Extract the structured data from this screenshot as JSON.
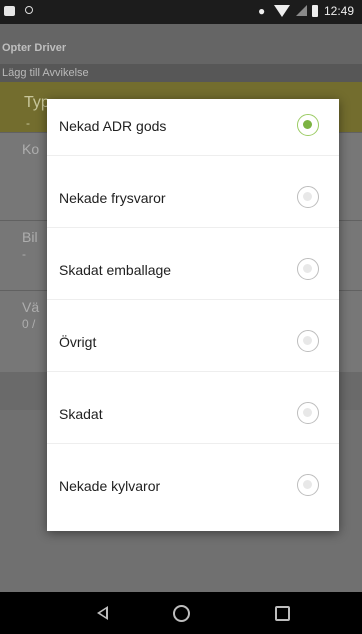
{
  "status_bar": {
    "time": "12:49",
    "icons": [
      "notification-icon",
      "location-icon",
      "wifi-icon",
      "signal-icon",
      "battery-icon"
    ]
  },
  "app": {
    "title": "Opter Driver",
    "subtitle": "Lägg till Avvikelse"
  },
  "form": {
    "type_field": {
      "label": "Typ",
      "value": "-"
    },
    "fields": [
      {
        "label": "Ko",
        "value": ""
      },
      {
        "label": "Bil",
        "value": "-"
      },
      {
        "label": "Vä",
        "value": "0 /"
      }
    ]
  },
  "dialog": {
    "options": [
      {
        "label": "Nekad ADR gods",
        "selected": true
      },
      {
        "label": "Nekade frysvaror",
        "selected": false
      },
      {
        "label": "Skadat emballage",
        "selected": false
      },
      {
        "label": "Övrigt",
        "selected": false
      },
      {
        "label": "Skadat",
        "selected": false
      },
      {
        "label": "Nekade kylvaror",
        "selected": false
      }
    ]
  },
  "colors": {
    "accent_radio": "#7cb342",
    "typ_field_bg": "#7d7732",
    "dialog_bg": "#ffffff"
  },
  "nav_bar": {
    "icons": [
      "back-icon",
      "home-icon",
      "recents-icon"
    ]
  }
}
